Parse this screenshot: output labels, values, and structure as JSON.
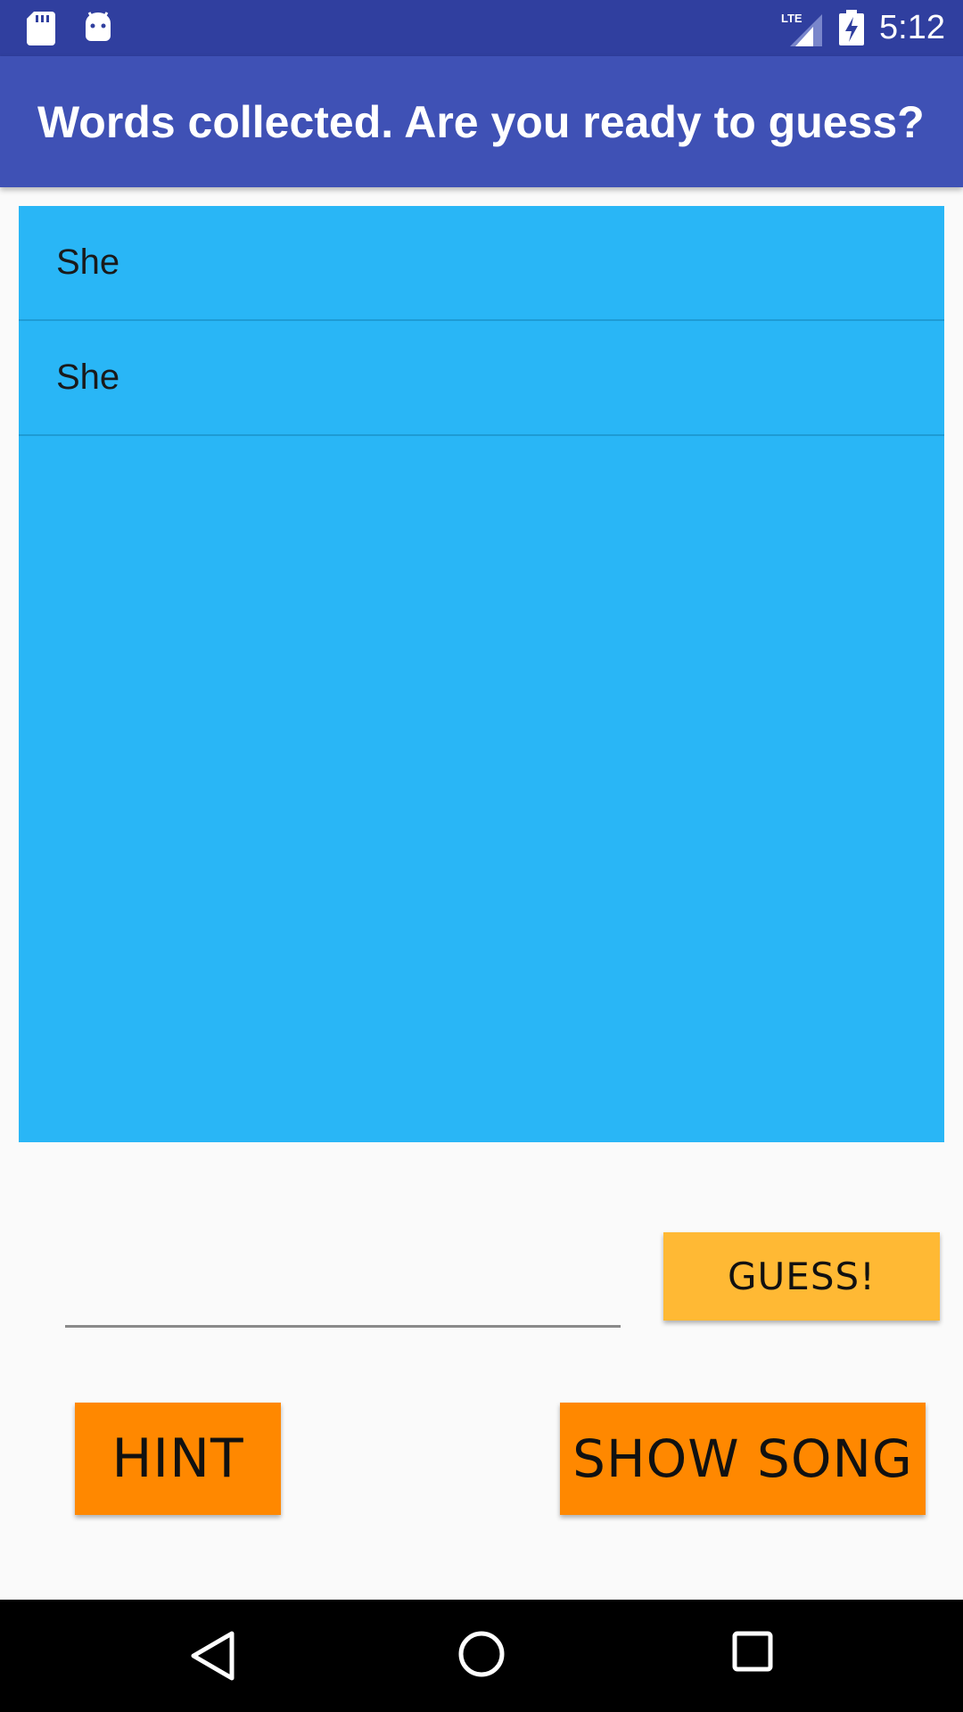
{
  "status_bar": {
    "time": "5:12",
    "network_label": "LTE",
    "icons": [
      "sd-card-icon",
      "android-icon",
      "lte-signal-icon",
      "battery-charging-icon"
    ]
  },
  "app_bar": {
    "title": "Words collected. Are you ready to guess?"
  },
  "word_list": {
    "items": [
      "She",
      "She"
    ]
  },
  "guess": {
    "input_value": "",
    "button_label": "GUESS!"
  },
  "actions": {
    "hint_label": "HINT",
    "show_song_label": "SHOW SONG"
  },
  "nav_bar": {
    "icons": [
      "back-icon",
      "home-icon",
      "recents-icon"
    ]
  },
  "colors": {
    "status_bar": "#303f9f",
    "app_bar": "#3f51b5",
    "list_background": "#29b6f6",
    "guess_button": "#ffb934",
    "action_buttons": "#ff8800",
    "page_background": "#fafafa"
  }
}
